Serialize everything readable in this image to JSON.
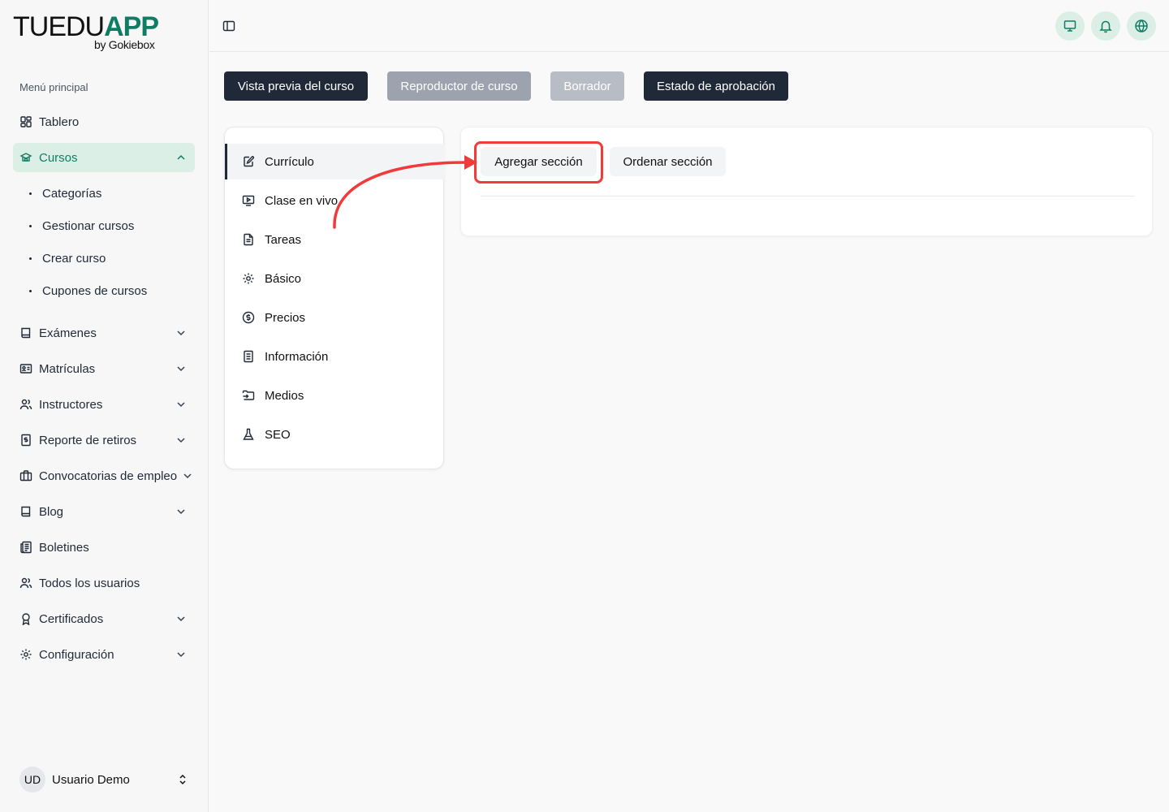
{
  "brand": {
    "name_part1": "TUEDU",
    "name_part2": "APP",
    "sub": "by Gokiebox",
    "accent": "#0f7d63"
  },
  "sidebar": {
    "menu_label": "Menú principal",
    "items": [
      {
        "label": "Tablero",
        "icon": "dashboard-icon"
      },
      {
        "label": "Cursos",
        "icon": "courses-icon",
        "active": true
      },
      {
        "label": "Exámenes",
        "icon": "book-icon"
      },
      {
        "label": "Matrículas",
        "icon": "id-card-icon"
      },
      {
        "label": "Instructores",
        "icon": "users-icon"
      },
      {
        "label": "Reporte de retiros",
        "icon": "receipt-icon"
      },
      {
        "label": "Convocatorias de empleo",
        "icon": "briefcase-icon"
      },
      {
        "label": "Blog",
        "icon": "book-icon"
      },
      {
        "label": "Boletines",
        "icon": "newspaper-icon"
      },
      {
        "label": "Todos los usuarios",
        "icon": "users-icon"
      },
      {
        "label": "Certificados",
        "icon": "award-icon"
      },
      {
        "label": "Configuración",
        "icon": "gear-icon"
      }
    ],
    "sub_items": [
      "Categorías",
      "Gestionar cursos",
      "Crear curso",
      "Cupones de cursos"
    ]
  },
  "user": {
    "initials": "UD",
    "name": "Usuario Demo"
  },
  "actions": {
    "preview": "Vista previa del curso",
    "player": "Reproductor de curso",
    "draft": "Borrador",
    "approval": "Estado de aprobación"
  },
  "tabs": [
    {
      "label": "Currículo",
      "icon": "edit-icon",
      "active": true
    },
    {
      "label": "Clase en vivo",
      "icon": "monitor-play-icon"
    },
    {
      "label": "Tareas",
      "icon": "file-text-icon"
    },
    {
      "label": "Básico",
      "icon": "gear-icon"
    },
    {
      "label": "Precios",
      "icon": "dollar-circle-icon"
    },
    {
      "label": "Información",
      "icon": "document-icon"
    },
    {
      "label": "Medios",
      "icon": "media-icon"
    },
    {
      "label": "SEO",
      "icon": "flask-icon"
    }
  ],
  "curriculum": {
    "add_section": "Agregar sección",
    "order_section": "Ordenar sección"
  },
  "colors": {
    "highlight": "#ef3b3b",
    "dark_button": "#1f2937"
  }
}
